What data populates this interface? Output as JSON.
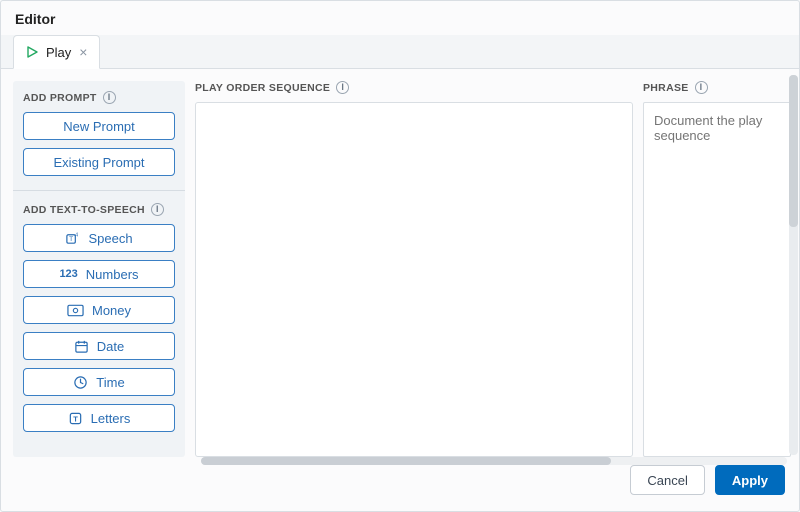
{
  "panel_title": "Editor",
  "tab": {
    "label": "Play"
  },
  "sidebar": {
    "add_prompt_title": "ADD PROMPT",
    "add_tts_title": "ADD TEXT-TO-SPEECH",
    "prompt_buttons": [
      {
        "label": "New Prompt"
      },
      {
        "label": "Existing Prompt"
      }
    ],
    "tts_buttons": [
      {
        "label": "Speech",
        "icon": "speech"
      },
      {
        "label": "Numbers",
        "icon": "numbers"
      },
      {
        "label": "Money",
        "icon": "money"
      },
      {
        "label": "Date",
        "icon": "date"
      },
      {
        "label": "Time",
        "icon": "time"
      },
      {
        "label": "Letters",
        "icon": "letters"
      }
    ]
  },
  "columns": {
    "sequence_title": "PLAY ORDER SEQUENCE",
    "phrase_title": "PHRASE"
  },
  "phrase_placeholder": "Document the play sequence",
  "footer": {
    "cancel": "Cancel",
    "apply": "Apply"
  },
  "info_glyph": "i",
  "close_glyph": "×"
}
